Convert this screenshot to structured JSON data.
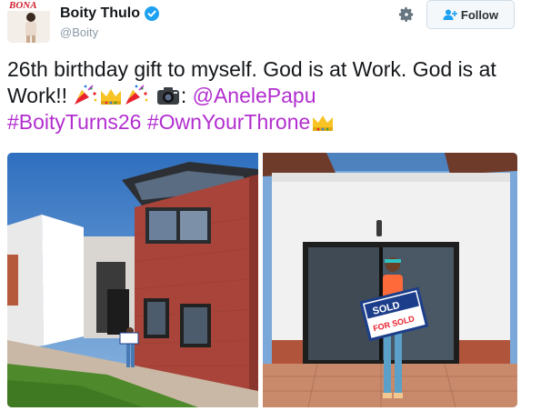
{
  "profile": {
    "display_name": "Boity Thulo",
    "handle": "@Boity",
    "avatar_brand": "BONA",
    "verified": true
  },
  "actions": {
    "follow_label": "Follow"
  },
  "tweet": {
    "text_part1": "26th birthday gift to myself. God is at Work. God is at Work!! ",
    "camera_separator": ": ",
    "mention": "@AnelePapu",
    "hashtag1": "#BoityTurns26",
    "hashtag2": "#OwnYourThrone",
    "emojis": [
      "party-popper",
      "crown",
      "party-popper",
      "camera",
      "crown"
    ]
  },
  "photos": {
    "right_sign_text": "SOLD",
    "right_sign_sub": "FOR SOLD"
  },
  "colors": {
    "link": "#b22ecf",
    "verified": "#1da1f2",
    "text": "#14171a",
    "muted": "#8899a6"
  }
}
